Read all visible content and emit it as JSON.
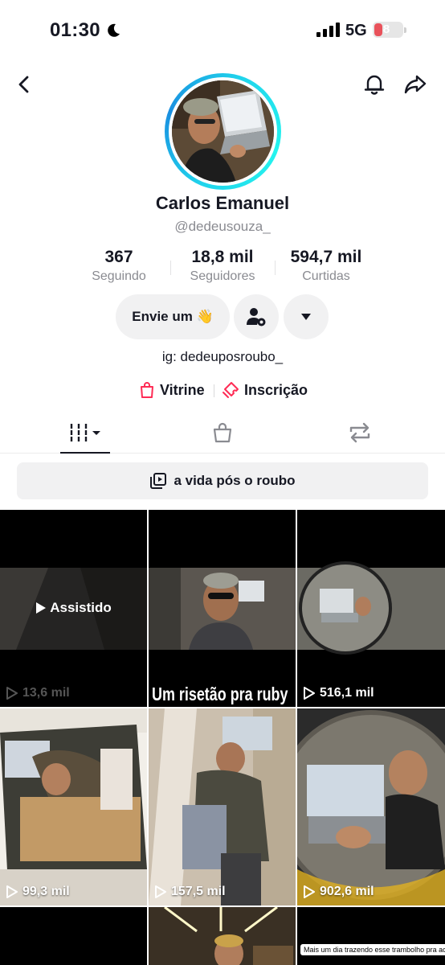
{
  "status": {
    "time": "01:30",
    "network": "5G",
    "battery": "8"
  },
  "profile": {
    "name": "Carlos Emanuel",
    "username": "@dedeusouza_",
    "stats": [
      {
        "value": "367",
        "label": "Seguindo"
      },
      {
        "value": "18,8 mil",
        "label": "Seguidores"
      },
      {
        "value": "594,7 mil",
        "label": "Curtidas"
      }
    ],
    "message_button": "Envie um 👋",
    "bio": "ig: dedeuposroubo_",
    "links": {
      "showcase": "Vitrine",
      "subscription": "Inscrição"
    }
  },
  "playlist": {
    "label": "a vida pós o roubo"
  },
  "videos": [
    {
      "views": "13,6 mil",
      "badge": "Assistido"
    },
    {
      "views": "",
      "caption": "Um risetão pra ruby"
    },
    {
      "views": "516,1 mil"
    },
    {
      "views": "99,3 mil"
    },
    {
      "views": "157,5 mil"
    },
    {
      "views": "902,6 mil"
    },
    {
      "views": ""
    },
    {
      "views": ""
    },
    {
      "views": "",
      "caption": "Mais um dia trazendo esse trambolho pra academia"
    }
  ],
  "colors": {
    "accent": "#fe2c55",
    "ring": "#20d5ec",
    "text": "#161823",
    "muted": "#8a8b91"
  },
  "icons": [
    "moon-icon",
    "back-icon",
    "bell-icon",
    "share-icon",
    "wave-emoji",
    "add-friend-gear-icon",
    "chevron-down-icon",
    "bag-icon",
    "ticket-icon",
    "grid-icon",
    "shop-bag-icon",
    "repost-icon",
    "playlist-icon",
    "play-icon"
  ]
}
